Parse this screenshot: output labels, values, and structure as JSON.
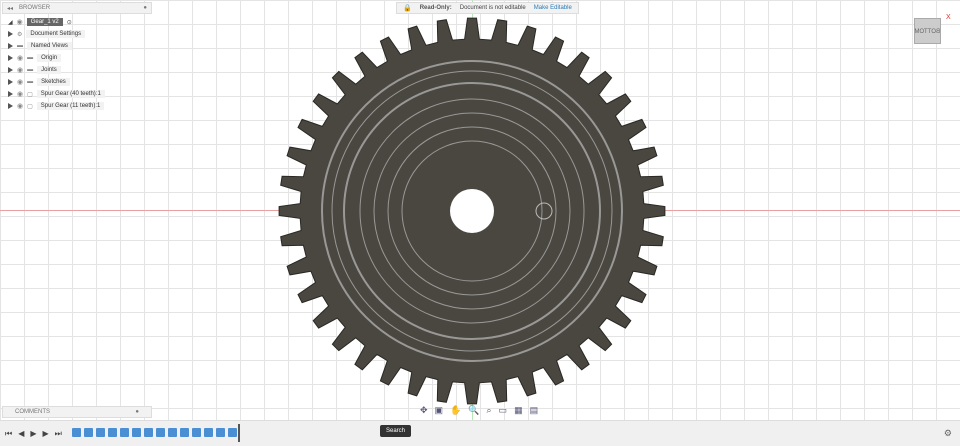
{
  "browser": {
    "title": "BROWSER",
    "root": "Gear_1 v2",
    "items": [
      {
        "label": "Document Settings",
        "icon": "gear-icon"
      },
      {
        "label": "Named Views",
        "icon": "folder-icon"
      },
      {
        "label": "Origin",
        "icon": "folder-icon"
      },
      {
        "label": "Joints",
        "icon": "folder-icon"
      },
      {
        "label": "Sketches",
        "icon": "folder-icon"
      },
      {
        "label": "Spur Gear (40 teeth):1",
        "icon": "component-icon"
      },
      {
        "label": "Spur Gear (11 teeth):1",
        "icon": "component-icon"
      }
    ]
  },
  "readonly": {
    "label": "Read-Only:",
    "message": "Document is not editable",
    "action": "Make Editable"
  },
  "viewcube": {
    "face": "BOTTOM",
    "axis": "X"
  },
  "comments": {
    "title": "COMMENTS"
  },
  "search": {
    "label": "Search"
  },
  "gear": {
    "teeth": 40,
    "fill": "#4a4740"
  },
  "colors": {
    "accent": "#2a7ab8",
    "timeline_pink": "#e8409a",
    "timeline_cyan": "#40c8e8"
  }
}
